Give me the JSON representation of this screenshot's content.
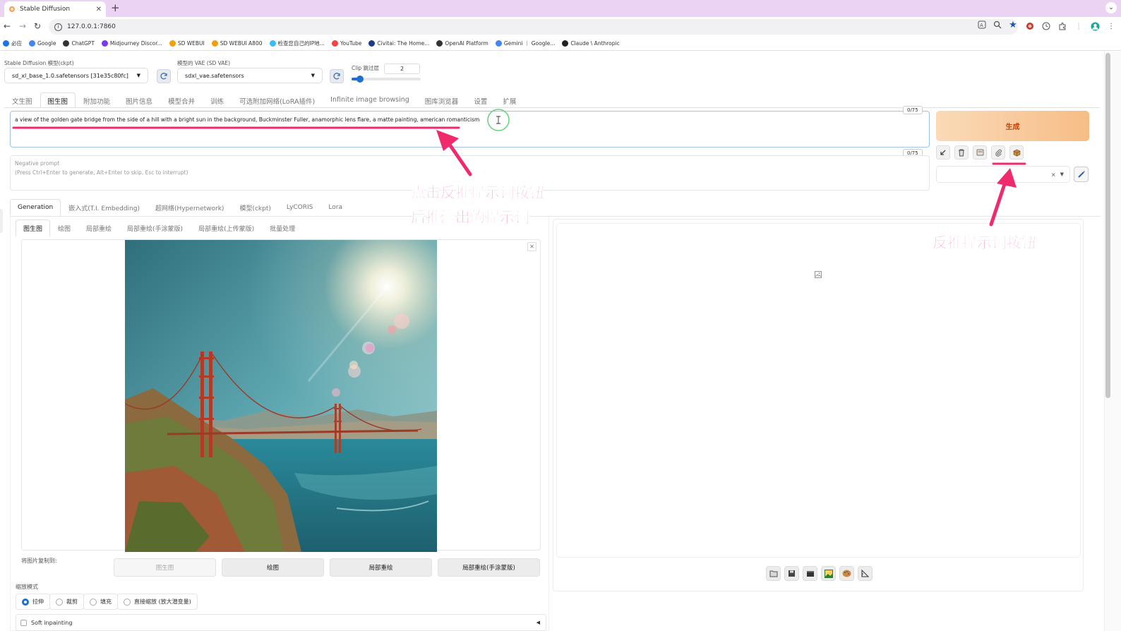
{
  "browser": {
    "tab_title": "Stable Diffusion",
    "new_tab": "+",
    "url": "127.0.0.1:7860"
  },
  "bookmarks": [
    {
      "label": "必应",
      "color": "#1b73e8"
    },
    {
      "label": "Google",
      "color": "#4285f4"
    },
    {
      "label": "ChatGPT",
      "color": "#333333"
    },
    {
      "label": "Midjourney Discor...",
      "color": "#7c3aed"
    },
    {
      "label": "SD WEBUI",
      "color": "#f59e0b"
    },
    {
      "label": "SD WEBUI A800",
      "color": "#f59e0b"
    },
    {
      "label": "检查您自己的IP地...",
      "color": "#38bdf8"
    },
    {
      "label": "YouTube",
      "color": "#ef4444"
    },
    {
      "label": "Civitai: The Home...",
      "color": "#1e3a8a"
    },
    {
      "label": "OpenAI Platform",
      "color": "#333333"
    },
    {
      "label": "Gemini ｜ Google...",
      "color": "#4285f4"
    },
    {
      "label": "Claude \\ Anthropic",
      "color": "#222222"
    }
  ],
  "settings": {
    "ckpt_label": "Stable Diffusion 模型(ckpt)",
    "ckpt_value": "sd_xl_base_1.0.safetensors [31e35c80fc]",
    "vae_label": "模型的 VAE (SD VAE)",
    "vae_value": "sdxl_vae.safetensors",
    "clip_label": "Clip 跳过层",
    "clip_value": "2",
    "clip_level": 0.1
  },
  "main_tabs": [
    "文生图",
    "图生图",
    "附加功能",
    "图片信息",
    "模型合并",
    "训练",
    "可选附加网络(LoRA插件)",
    "Infinite image browsing",
    "图库浏览器",
    "设置",
    "扩展"
  ],
  "prompt": {
    "text": "a view of the golden gate bridge from the side of a hill with a bright sun in the background, Buckminster Fuller, anamorphic lens flare, a matte painting, american romanticism",
    "counter": "0/75",
    "neg_counter": "0/75",
    "neg_placeholder_1": "Negative prompt",
    "neg_placeholder_2": "(Press Ctrl+Enter to generate, Alt+Enter to skip, Esc to interrupt)"
  },
  "generate_label": "生成",
  "style_clear": "×",
  "extra_tabs": [
    "Generation",
    "嵌入式(T.I. Embedding)",
    "超网络(Hypernetwork)",
    "模型(ckpt)",
    "LyCORIS",
    "Lora"
  ],
  "img_tabs": [
    "图生图",
    "绘图",
    "局部重绘",
    "局部重绘(手涂蒙版)",
    "局部重绘(上传蒙版)",
    "批量处理"
  ],
  "copy_to": {
    "label": "将图片复制到:",
    "buttons": [
      "图生图",
      "绘图",
      "局部重绘",
      "局部重绘(手涂蒙版)"
    ]
  },
  "resize": {
    "label": "缩放模式",
    "options": [
      "拉伸",
      "裁剪",
      "填充",
      "直接缩放 (放大潜变量)"
    ],
    "selected": "拉伸"
  },
  "soft_inpainting": "Soft inpainting",
  "annotations": {
    "left_line1": "点击反推提示词按钮",
    "left_line2": "后推测出的提示词",
    "right": "反推提示词按钮"
  },
  "colors": {
    "accent": "#f02b6c",
    "generate_text": "#c2410c",
    "primary": "#1f6fd1"
  }
}
